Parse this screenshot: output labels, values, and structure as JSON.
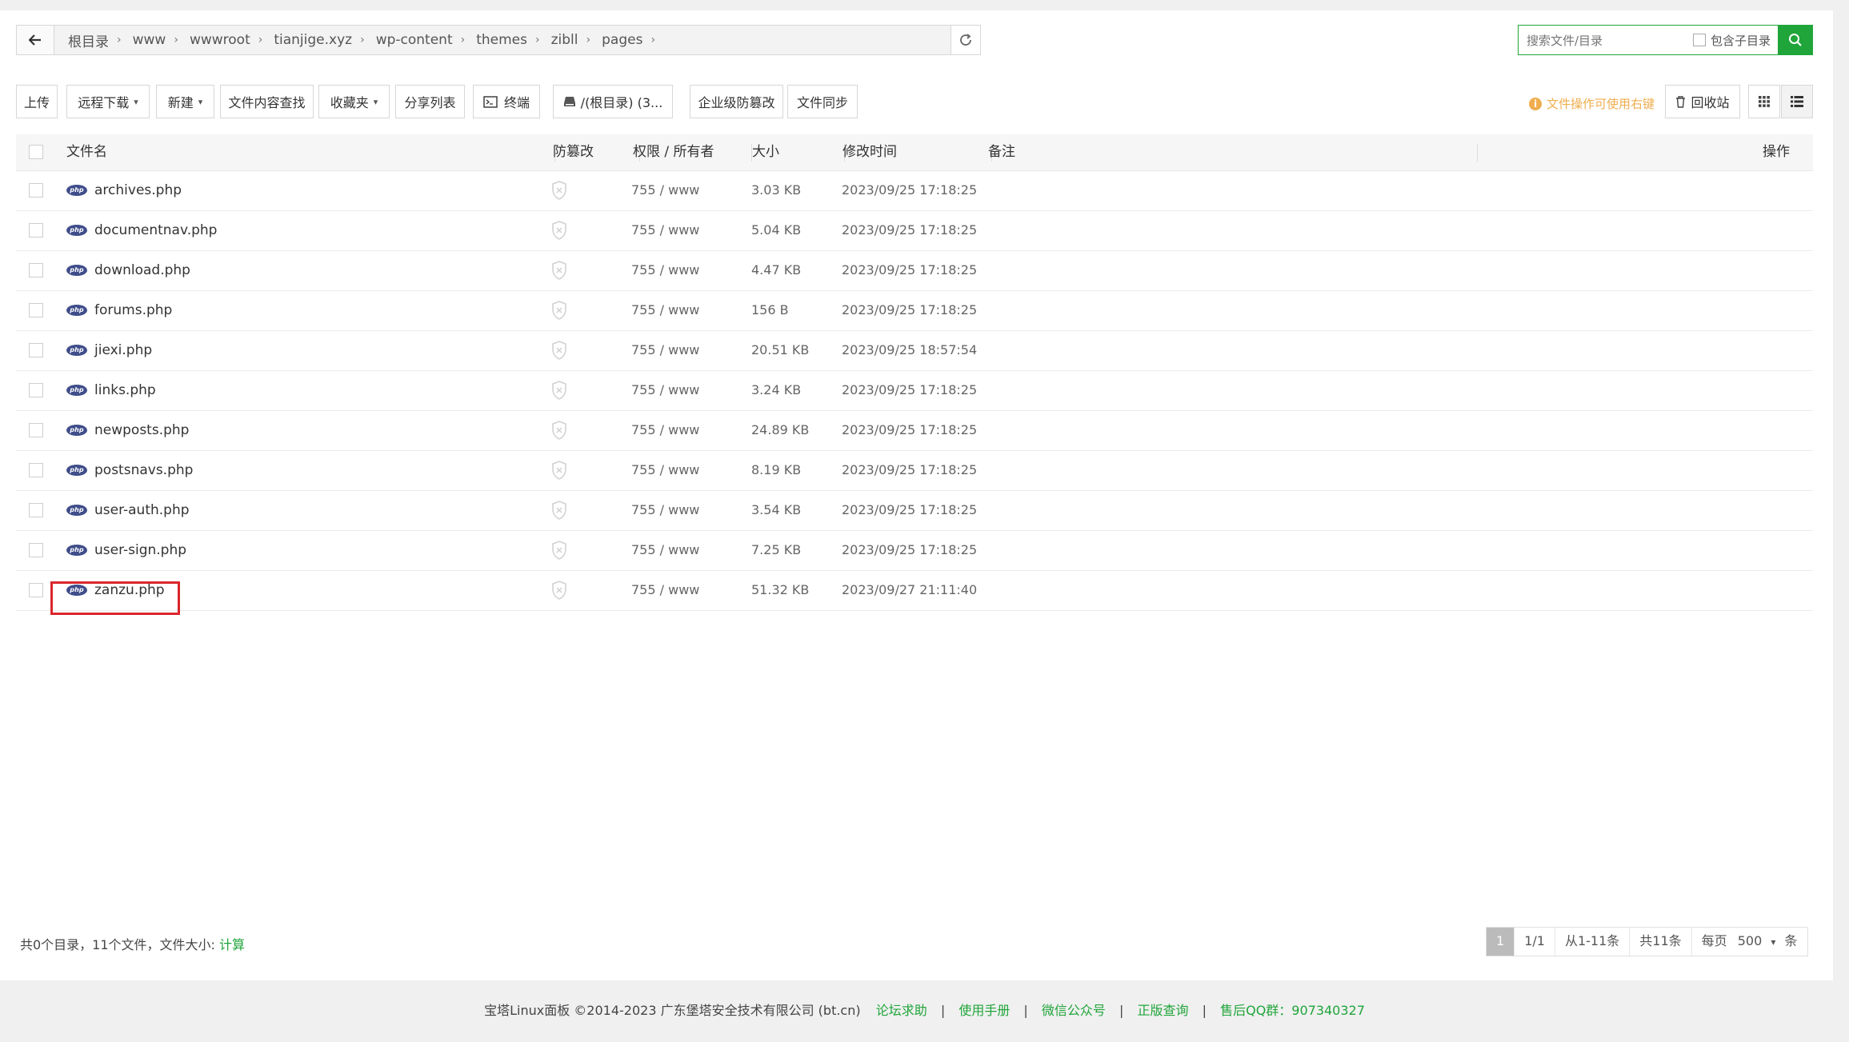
{
  "breadcrumb": [
    "根目录",
    "www",
    "wwwroot",
    "tianjige.xyz",
    "wp-content",
    "themes",
    "zibll",
    "pages"
  ],
  "search": {
    "placeholder": "搜索文件/目录",
    "subdir_label": "包含子目录"
  },
  "toolbar": {
    "upload": "上传",
    "remote_download": "远程下载",
    "new": "新建",
    "content_search": "文件内容查找",
    "favorites": "收藏夹",
    "share_list": "分享列表",
    "terminal": "终端",
    "disk": "/(根目录) (3...",
    "enterprise_tamper": "企业级防篡改",
    "file_sync": "文件同步",
    "right_click_tip": "文件操作可使用右键",
    "recycle_bin": "回收站"
  },
  "columns": {
    "name": "文件名",
    "tamper": "防篡改",
    "perm": "权限 / 所有者",
    "size": "大小",
    "mtime": "修改时间",
    "note": "备注",
    "action": "操作"
  },
  "files": [
    {
      "name": "archives.php",
      "perm": "755 / www",
      "size": "3.03 KB",
      "mtime": "2023/09/25 17:18:25"
    },
    {
      "name": "documentnav.php",
      "perm": "755 / www",
      "size": "5.04 KB",
      "mtime": "2023/09/25 17:18:25"
    },
    {
      "name": "download.php",
      "perm": "755 / www",
      "size": "4.47 KB",
      "mtime": "2023/09/25 17:18:25"
    },
    {
      "name": "forums.php",
      "perm": "755 / www",
      "size": "156 B",
      "mtime": "2023/09/25 17:18:25"
    },
    {
      "name": "jiexi.php",
      "perm": "755 / www",
      "size": "20.51 KB",
      "mtime": "2023/09/25 18:57:54"
    },
    {
      "name": "links.php",
      "perm": "755 / www",
      "size": "3.24 KB",
      "mtime": "2023/09/25 17:18:25"
    },
    {
      "name": "newposts.php",
      "perm": "755 / www",
      "size": "24.89 KB",
      "mtime": "2023/09/25 17:18:25"
    },
    {
      "name": "postsnavs.php",
      "perm": "755 / www",
      "size": "8.19 KB",
      "mtime": "2023/09/25 17:18:25"
    },
    {
      "name": "user-auth.php",
      "perm": "755 / www",
      "size": "3.54 KB",
      "mtime": "2023/09/25 17:18:25"
    },
    {
      "name": "user-sign.php",
      "perm": "755 / www",
      "size": "7.25 KB",
      "mtime": "2023/09/25 17:18:25"
    },
    {
      "name": "zanzu.php",
      "perm": "755 / www",
      "size": "51.32 KB",
      "mtime": "2023/09/27 21:11:40"
    }
  ],
  "file_icon_label": "php",
  "summary": {
    "text": "共0个目录，11个文件，文件大小:",
    "calc": "计算"
  },
  "pager": {
    "current": "1",
    "pages": "1/1",
    "range": "从1-11条",
    "total": "共11条",
    "per_page_label": "每页",
    "per_page": "500",
    "unit": "条"
  },
  "footer": {
    "copyright": "宝塔Linux面板 ©2014-2023 广东堡塔安全技术有限公司 (bt.cn)",
    "links": [
      "论坛求助",
      "使用手册",
      "微信公众号",
      "正版查询",
      "售后QQ群：907340327"
    ],
    "separator": "|"
  },
  "colors": {
    "accent": "#20a53a",
    "warning": "#f0ad4e",
    "highlight": "#d9262c",
    "php_icon": "#3f4d8a"
  }
}
